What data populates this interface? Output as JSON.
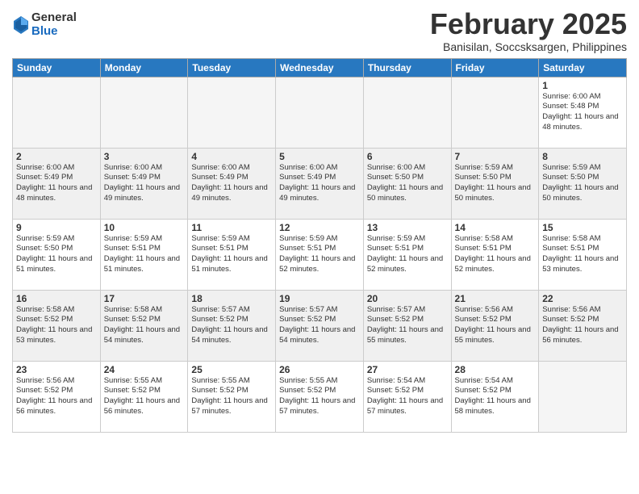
{
  "logo": {
    "general": "General",
    "blue": "Blue"
  },
  "title": "February 2025",
  "location": "Banisilan, Soccsksargen, Philippines",
  "weekdays": [
    "Sunday",
    "Monday",
    "Tuesday",
    "Wednesday",
    "Thursday",
    "Friday",
    "Saturday"
  ],
  "weeks": [
    [
      {
        "day": "",
        "info": ""
      },
      {
        "day": "",
        "info": ""
      },
      {
        "day": "",
        "info": ""
      },
      {
        "day": "",
        "info": ""
      },
      {
        "day": "",
        "info": ""
      },
      {
        "day": "",
        "info": ""
      },
      {
        "day": "1",
        "info": "Sunrise: 6:00 AM\nSunset: 5:48 PM\nDaylight: 11 hours and 48 minutes."
      }
    ],
    [
      {
        "day": "2",
        "info": "Sunrise: 6:00 AM\nSunset: 5:49 PM\nDaylight: 11 hours and 48 minutes."
      },
      {
        "day": "3",
        "info": "Sunrise: 6:00 AM\nSunset: 5:49 PM\nDaylight: 11 hours and 49 minutes."
      },
      {
        "day": "4",
        "info": "Sunrise: 6:00 AM\nSunset: 5:49 PM\nDaylight: 11 hours and 49 minutes."
      },
      {
        "day": "5",
        "info": "Sunrise: 6:00 AM\nSunset: 5:49 PM\nDaylight: 11 hours and 49 minutes."
      },
      {
        "day": "6",
        "info": "Sunrise: 6:00 AM\nSunset: 5:50 PM\nDaylight: 11 hours and 50 minutes."
      },
      {
        "day": "7",
        "info": "Sunrise: 5:59 AM\nSunset: 5:50 PM\nDaylight: 11 hours and 50 minutes."
      },
      {
        "day": "8",
        "info": "Sunrise: 5:59 AM\nSunset: 5:50 PM\nDaylight: 11 hours and 50 minutes."
      }
    ],
    [
      {
        "day": "9",
        "info": "Sunrise: 5:59 AM\nSunset: 5:50 PM\nDaylight: 11 hours and 51 minutes."
      },
      {
        "day": "10",
        "info": "Sunrise: 5:59 AM\nSunset: 5:51 PM\nDaylight: 11 hours and 51 minutes."
      },
      {
        "day": "11",
        "info": "Sunrise: 5:59 AM\nSunset: 5:51 PM\nDaylight: 11 hours and 51 minutes."
      },
      {
        "day": "12",
        "info": "Sunrise: 5:59 AM\nSunset: 5:51 PM\nDaylight: 11 hours and 52 minutes."
      },
      {
        "day": "13",
        "info": "Sunrise: 5:59 AM\nSunset: 5:51 PM\nDaylight: 11 hours and 52 minutes."
      },
      {
        "day": "14",
        "info": "Sunrise: 5:58 AM\nSunset: 5:51 PM\nDaylight: 11 hours and 52 minutes."
      },
      {
        "day": "15",
        "info": "Sunrise: 5:58 AM\nSunset: 5:51 PM\nDaylight: 11 hours and 53 minutes."
      }
    ],
    [
      {
        "day": "16",
        "info": "Sunrise: 5:58 AM\nSunset: 5:52 PM\nDaylight: 11 hours and 53 minutes."
      },
      {
        "day": "17",
        "info": "Sunrise: 5:58 AM\nSunset: 5:52 PM\nDaylight: 11 hours and 54 minutes."
      },
      {
        "day": "18",
        "info": "Sunrise: 5:57 AM\nSunset: 5:52 PM\nDaylight: 11 hours and 54 minutes."
      },
      {
        "day": "19",
        "info": "Sunrise: 5:57 AM\nSunset: 5:52 PM\nDaylight: 11 hours and 54 minutes."
      },
      {
        "day": "20",
        "info": "Sunrise: 5:57 AM\nSunset: 5:52 PM\nDaylight: 11 hours and 55 minutes."
      },
      {
        "day": "21",
        "info": "Sunrise: 5:56 AM\nSunset: 5:52 PM\nDaylight: 11 hours and 55 minutes."
      },
      {
        "day": "22",
        "info": "Sunrise: 5:56 AM\nSunset: 5:52 PM\nDaylight: 11 hours and 56 minutes."
      }
    ],
    [
      {
        "day": "23",
        "info": "Sunrise: 5:56 AM\nSunset: 5:52 PM\nDaylight: 11 hours and 56 minutes."
      },
      {
        "day": "24",
        "info": "Sunrise: 5:55 AM\nSunset: 5:52 PM\nDaylight: 11 hours and 56 minutes."
      },
      {
        "day": "25",
        "info": "Sunrise: 5:55 AM\nSunset: 5:52 PM\nDaylight: 11 hours and 57 minutes."
      },
      {
        "day": "26",
        "info": "Sunrise: 5:55 AM\nSunset: 5:52 PM\nDaylight: 11 hours and 57 minutes."
      },
      {
        "day": "27",
        "info": "Sunrise: 5:54 AM\nSunset: 5:52 PM\nDaylight: 11 hours and 57 minutes."
      },
      {
        "day": "28",
        "info": "Sunrise: 5:54 AM\nSunset: 5:52 PM\nDaylight: 11 hours and 58 minutes."
      },
      {
        "day": "",
        "info": ""
      }
    ]
  ]
}
